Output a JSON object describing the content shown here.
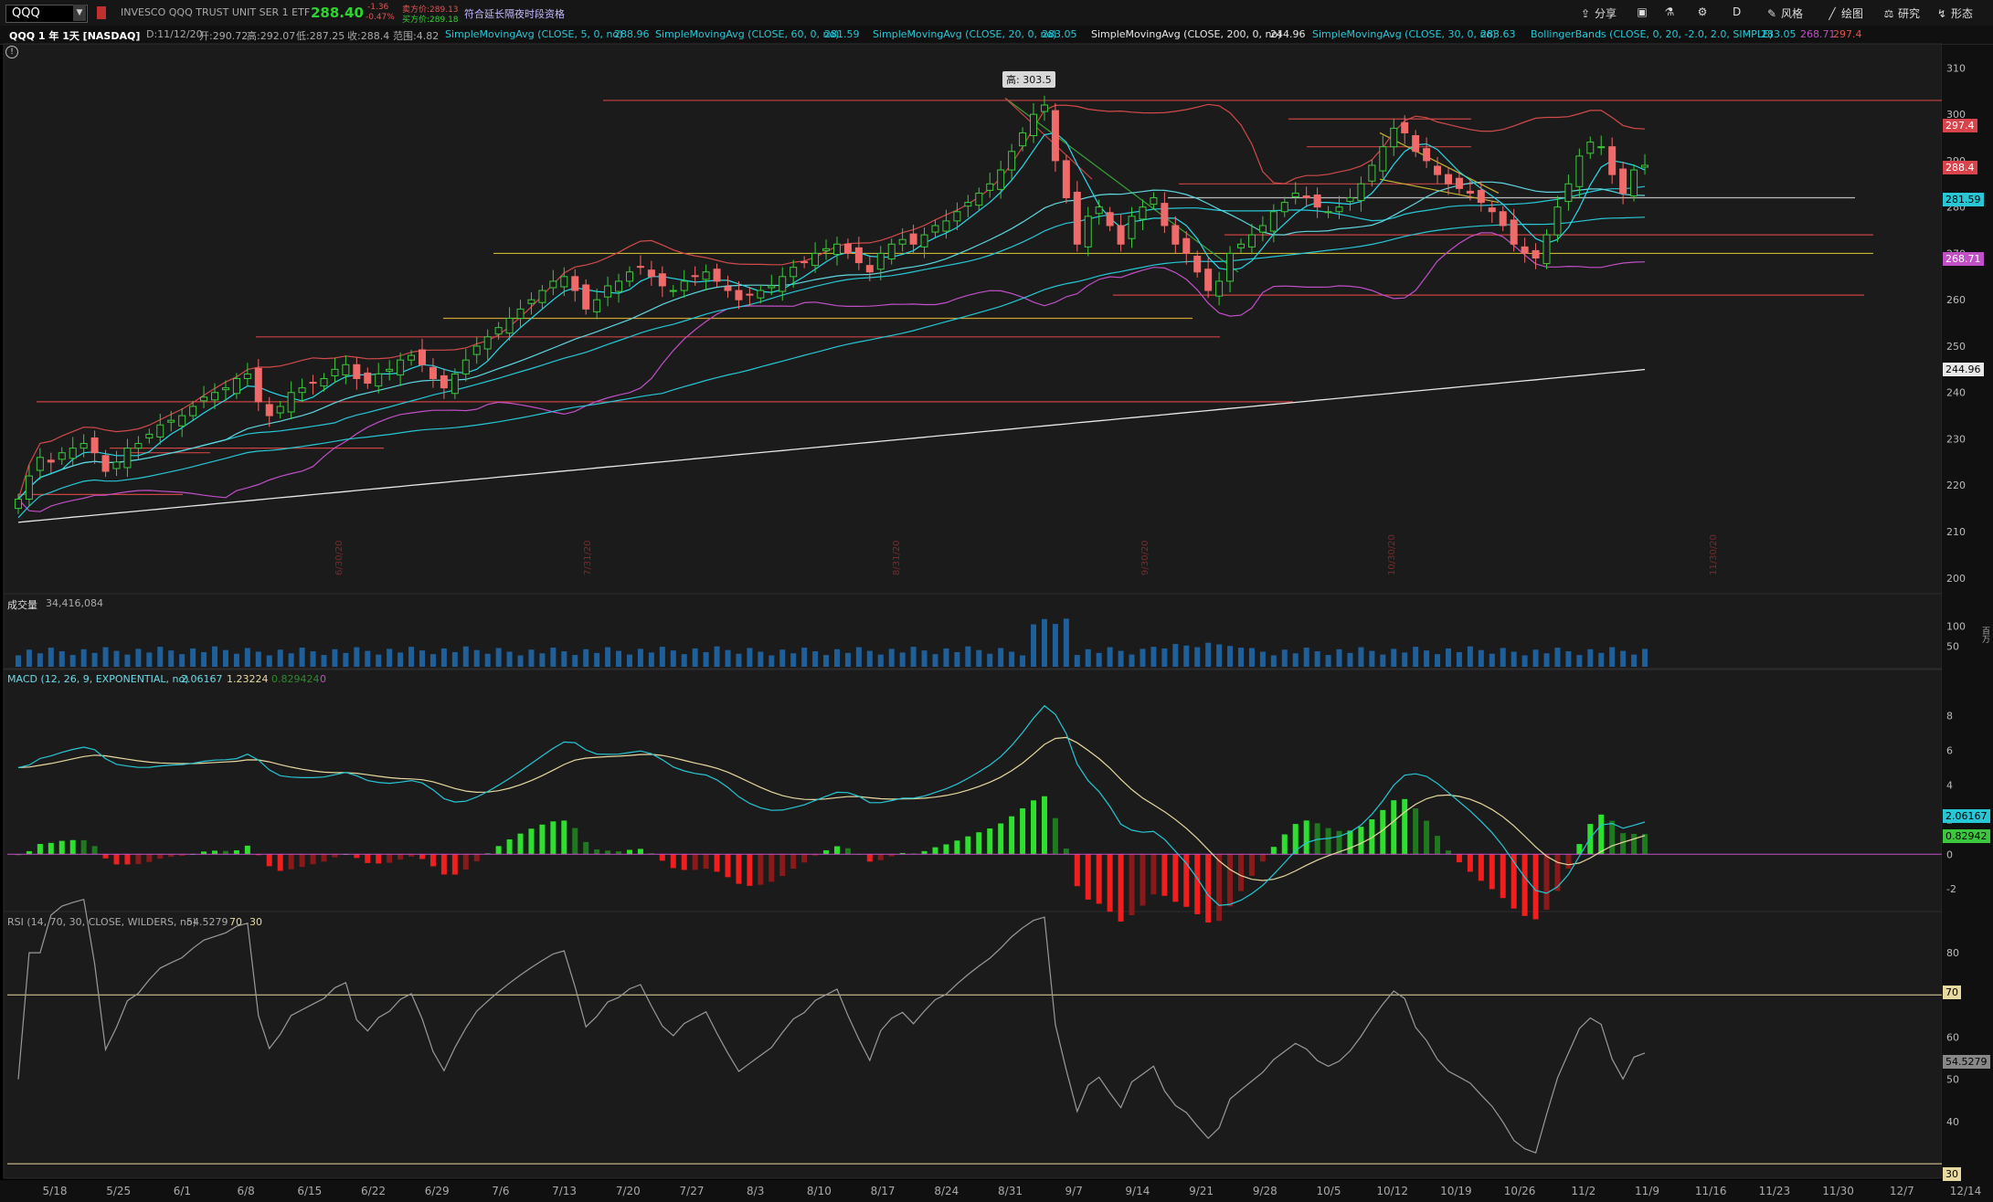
{
  "header": {
    "symbol": "QQQ",
    "description": "INVESCO QQQ TRUST UNIT SER 1 ETF",
    "last_price": "288.40",
    "change": "-1.36",
    "change_pct": "-0.47%",
    "ask": "卖方价:289.13",
    "bid": "买方价:289.18",
    "extended_hours": "符合延长隔夜时段资格",
    "toolbar": [
      {
        "icon": "share-icon",
        "label": "分享"
      },
      {
        "icon": "layout-icon",
        "label": ""
      },
      {
        "icon": "flask-icon",
        "label": ""
      },
      {
        "icon": "gear-icon",
        "label": ""
      },
      {
        "icon": "",
        "label": "D"
      },
      {
        "icon": "style-icon",
        "label": "风格"
      },
      {
        "icon": "draw-icon",
        "label": "绘图"
      },
      {
        "icon": "studies-icon",
        "label": "研究"
      },
      {
        "icon": "patterns-icon",
        "label": "形态"
      }
    ]
  },
  "studybar": {
    "title": "QQQ 1 年 1天 [NASDAQ]",
    "date": "D:11/12/20",
    "open": "开:290.72",
    "high": "高:292.07",
    "low": "低:287.25",
    "close": "收:288.4",
    "range": "范围:4.82",
    "studies": [
      {
        "label": "SimpleMovingAvg (CLOSE, 5, 0, no)",
        "value": "288.96",
        "color": "#27c7d6"
      },
      {
        "label": "SimpleMovingAvg (CLOSE, 60, 0, no)",
        "value": "281.59",
        "color": "#27c7d6"
      },
      {
        "label": "SimpleMovingAvg (CLOSE, 20, 0, no)",
        "value": "283.05",
        "color": "#27c7d6"
      },
      {
        "label": "SimpleMovingAvg (CLOSE, 200, 0, no)",
        "value": "244.96",
        "color": "#e8e8e8"
      },
      {
        "label": "SimpleMovingAvg (CLOSE, 30, 0, no)",
        "value": "283.63",
        "color": "#27c7d6"
      },
      {
        "label": "BollingerBands (CLOSE, 0, 20, -2.0, 2.0, SIMPLE)",
        "value": "283.05",
        "color": "#27c7d6"
      }
    ],
    "bb_lower": "268.71",
    "bb_upper": "297.4"
  },
  "price_panel": {
    "high_marker": "高: 303.5",
    "y_ticks": [
      "310",
      "300",
      "290",
      "280",
      "270",
      "260",
      "250",
      "240",
      "230",
      "220",
      "210",
      "200"
    ],
    "tags": [
      {
        "text": "297.4",
        "bg": "#d9434c",
        "fg": "#ffffff"
      },
      {
        "text": "288.4",
        "bg": "#d9434c",
        "fg": "#ffffff"
      },
      {
        "text": "281.59",
        "bg": "#27c7d6",
        "fg": "#000000"
      },
      {
        "text": "268.71",
        "bg": "#c14fc8",
        "fg": "#ffffff"
      },
      {
        "text": "244.96",
        "bg": "#e8e8e8",
        "fg": "#000000"
      }
    ],
    "vline_labels": [
      "6/30/20",
      "7/31/20",
      "8/31/20",
      "9/30/20",
      "10/30/20",
      "11/30/20"
    ]
  },
  "volume_panel": {
    "title": "成交量",
    "value": "34,416,084",
    "y_ticks": [
      "100",
      "50"
    ],
    "unit": "百万"
  },
  "macd_panel": {
    "title": "MACD (12, 26, 9, EXPONENTIAL, no)",
    "value": "2.06167",
    "avg": "1.23224",
    "diff": "0.829424",
    "zero": "0",
    "y_ticks": [
      "8",
      "6",
      "4",
      "2",
      "0",
      "-2"
    ],
    "tag_value": "2.06167",
    "tag_avg": "0.82942"
  },
  "rsi_panel": {
    "title": "RSI (14, 70, 30, CLOSE, WILDERS, no)",
    "value": "54.5279",
    "overbought": "70",
    "oversold": "30",
    "y_ticks": [
      "80",
      "60",
      "50",
      "40"
    ],
    "tag_value": "54.5279",
    "tag_ob": "70",
    "tag_os": "30"
  },
  "x_axis": [
    "5/18",
    "5/25",
    "6/1",
    "6/8",
    "6/15",
    "6/22",
    "6/29",
    "7/6",
    "7/13",
    "7/20",
    "7/27",
    "8/3",
    "8/10",
    "8/17",
    "8/24",
    "8/31",
    "9/7",
    "9/14",
    "9/21",
    "9/28",
    "10/5",
    "10/12",
    "10/19",
    "10/26",
    "11/2",
    "11/9",
    "11/16",
    "11/23",
    "11/30",
    "12/7",
    "12/14"
  ],
  "chart_data": {
    "type": "candlestick",
    "y_range": [
      197,
      315
    ],
    "closes": [
      217,
      222,
      226,
      225,
      227,
      228,
      229,
      227,
      223,
      225,
      228,
      229,
      231,
      233,
      234,
      235,
      237,
      239,
      240,
      241,
      243,
      244,
      238,
      235,
      237,
      240,
      241,
      242,
      243,
      245,
      246,
      243,
      242,
      244,
      245,
      247,
      248,
      246,
      243,
      241,
      244,
      247,
      250,
      252,
      254,
      256,
      258,
      260,
      262,
      264,
      265,
      262,
      258,
      260,
      263,
      264,
      266,
      267,
      265,
      263,
      262,
      264,
      265,
      266,
      264,
      262,
      260,
      261,
      262,
      263,
      265,
      267,
      268,
      270,
      271,
      272,
      270,
      268,
      266,
      270,
      272,
      273,
      272,
      274,
      276,
      277,
      279,
      281,
      283,
      285,
      288,
      292,
      296,
      300,
      302,
      290,
      282,
      272,
      278,
      280,
      276,
      272,
      278,
      280,
      282,
      276,
      272,
      270,
      266,
      262,
      264,
      270,
      272,
      274,
      276,
      279,
      281,
      283,
      282,
      280,
      279,
      280,
      282,
      285,
      289,
      293,
      297,
      296,
      292,
      290,
      287,
      285,
      284,
      283,
      281,
      279,
      276,
      272,
      270,
      269,
      274,
      280,
      285,
      291,
      294,
      293,
      287,
      283,
      288,
      289
    ]
  }
}
